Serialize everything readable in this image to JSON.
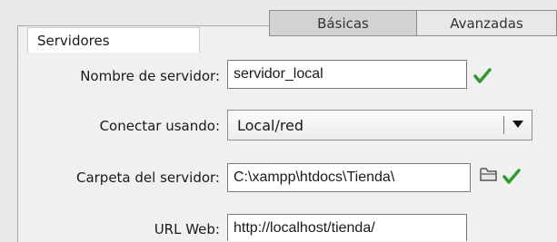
{
  "tabs": {
    "basicas": "Básicas",
    "avanzadas": "Avanzadas"
  },
  "section_tab": "Servidores",
  "form": {
    "server_name": {
      "label": "Nombre de servidor:",
      "value": "servidor_local"
    },
    "connect_using": {
      "label": "Conectar usando:",
      "value": "Local/red"
    },
    "server_folder": {
      "label": "Carpeta del servidor:",
      "value": "C:\\xampp\\htdocs\\Tienda\\"
    },
    "web_url": {
      "label": "URL Web:",
      "value": "http://localhost/tienda/"
    }
  },
  "colors": {
    "check": "#2d9b2d",
    "select_bg": "#f2f2f2",
    "tab_active": "#d2d2d2"
  },
  "icons": [
    "check-icon",
    "folder-icon",
    "dropdown-arrow-icon"
  ]
}
